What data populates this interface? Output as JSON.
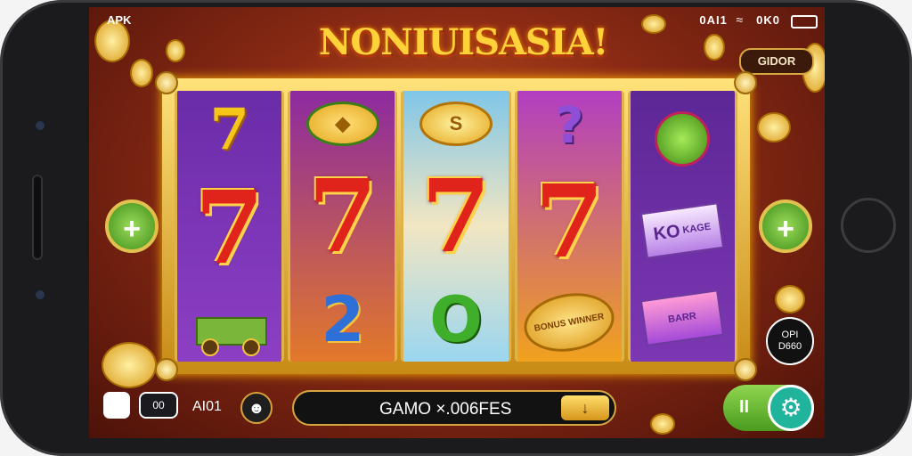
{
  "status": {
    "left": "APK",
    "right": "0AI1",
    "right2": "0K0"
  },
  "title": "NONIUISASIA!",
  "top_button": "GIDOR",
  "reels": [
    {
      "top": "7",
      "mid": "7",
      "bottom": "cart"
    },
    {
      "top": "fruit",
      "mid": "7",
      "bottom": "2"
    },
    {
      "top": "S",
      "mid": "7",
      "bottom": "O"
    },
    {
      "top": "?",
      "mid": "7",
      "bottom": "BONUS WINNER"
    },
    {
      "top": "cherry",
      "mid": "KO",
      "bottom": "BARR"
    }
  ],
  "reel4_bottom_label": "BONUS WINNER",
  "reel2_bottom": "2",
  "reel3_top": "S",
  "reel3_bottom": "O",
  "box_label": "KO",
  "box_label2": "KAGE",
  "box2_label": "BARR",
  "side_plus": "+",
  "info_line1": "OPI",
  "info_line2": "D660",
  "bottom": {
    "icon2": "00",
    "label": "AI01",
    "bet_text": "GAMO ×.006FES",
    "bet_chip": "↓",
    "spin_left": "II"
  },
  "colors": {
    "accent": "#ffd23a",
    "red": "#e0241c",
    "green": "#4a9b1f"
  }
}
